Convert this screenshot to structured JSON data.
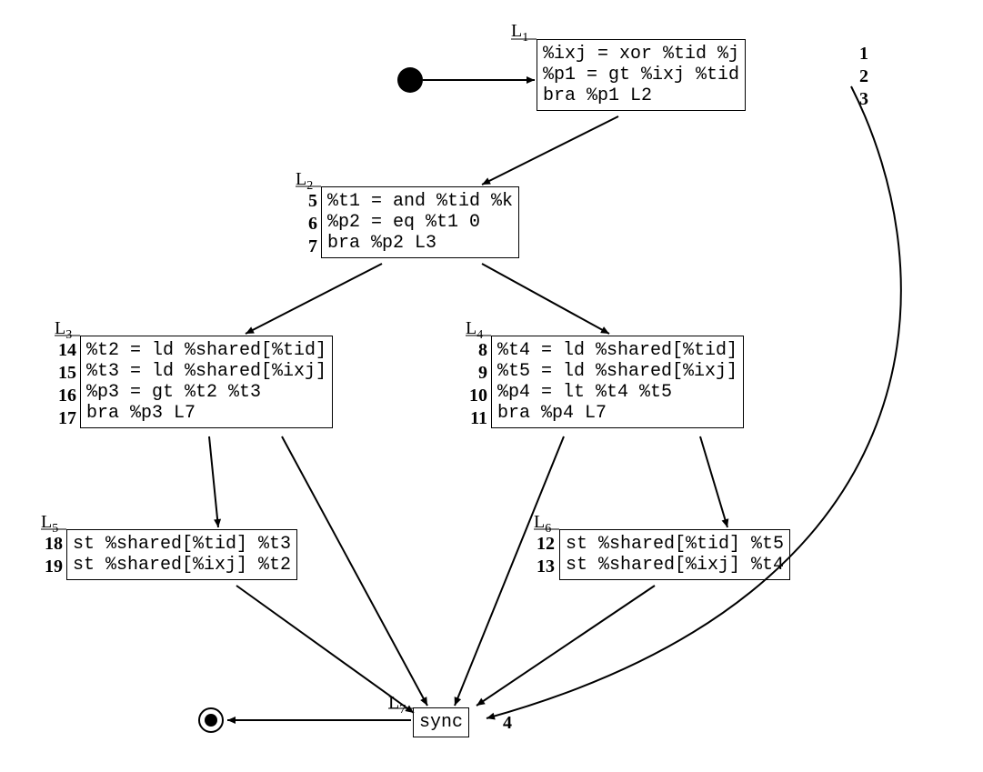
{
  "labels": {
    "L1": "L",
    "L1s": "1",
    "L2": "L",
    "L2s": "2",
    "L3": "L",
    "L3s": "3",
    "L4": "L",
    "L4s": "4",
    "L5": "L",
    "L5s": "5",
    "L6": "L",
    "L6s": "6",
    "L7": "L",
    "L7s": "7"
  },
  "blocks": {
    "L1": {
      "lines": [
        "%ixj = xor %tid %j",
        "%p1 = gt %ixj %tid",
        "bra %p1 L2"
      ],
      "nums": [
        "1",
        "2",
        "3"
      ]
    },
    "L2": {
      "lines": [
        "%t1 = and %tid %k",
        "%p2 = eq %t1 0",
        "bra %p2 L3"
      ],
      "nums": [
        "5",
        "6",
        "7"
      ]
    },
    "L3": {
      "lines": [
        "%t2 = ld %shared[%tid]",
        "%t3 = ld %shared[%ixj]",
        "%p3 = gt %t2 %t3",
        "bra %p3 L7"
      ],
      "nums": [
        "14",
        "15",
        "16",
        "17"
      ]
    },
    "L4": {
      "lines": [
        "%t4 = ld %shared[%tid]",
        "%t5 = ld %shared[%ixj]",
        "%p4 = lt %t4 %t5",
        "bra %p4 L7"
      ],
      "nums": [
        "8",
        "9",
        "10",
        "11"
      ]
    },
    "L5": {
      "lines": [
        "st %shared[%tid] %t3",
        "st %shared[%ixj] %t2"
      ],
      "nums": [
        "18",
        "19"
      ]
    },
    "L6": {
      "lines": [
        "st %shared[%tid] %t5",
        "st %shared[%ixj] %t4"
      ],
      "nums": [
        "12",
        "13"
      ]
    },
    "L7": {
      "lines": [
        "sync"
      ],
      "num_right": "4"
    }
  }
}
